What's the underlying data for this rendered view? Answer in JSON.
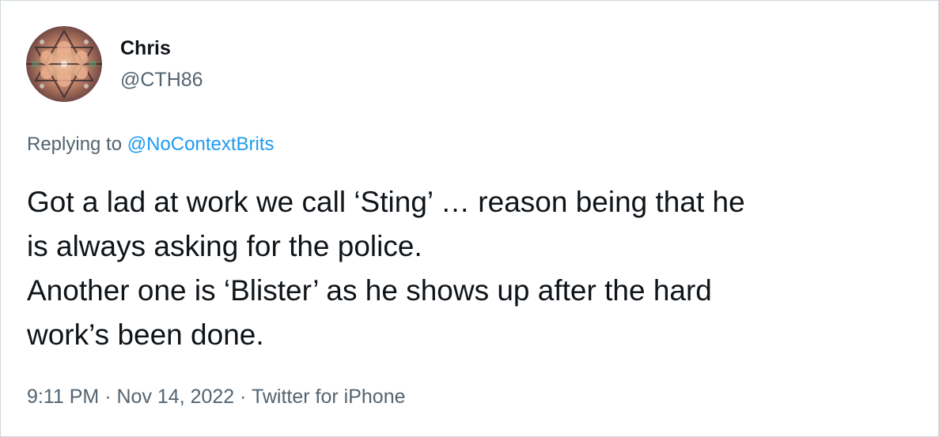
{
  "user": {
    "display_name": "Chris",
    "handle": "@CTH86"
  },
  "reply": {
    "prefix": "Replying to",
    "mention": "@NoContextBrits"
  },
  "tweet": {
    "lines": [
      "Got a lad at work we call ‘Sting’ … reason being that he",
      "is always asking for the police.",
      "Another one is ‘Blister’ as he shows up after the hard",
      "work’s been done."
    ]
  },
  "meta": {
    "time": "9:11 PM",
    "separator": "·",
    "date": "Nov 14, 2022",
    "source": "Twitter for iPhone"
  },
  "colors": {
    "text_primary": "#0f1419",
    "text_secondary": "#536471",
    "link": "#1d9bf0",
    "border": "#cfd9de"
  }
}
